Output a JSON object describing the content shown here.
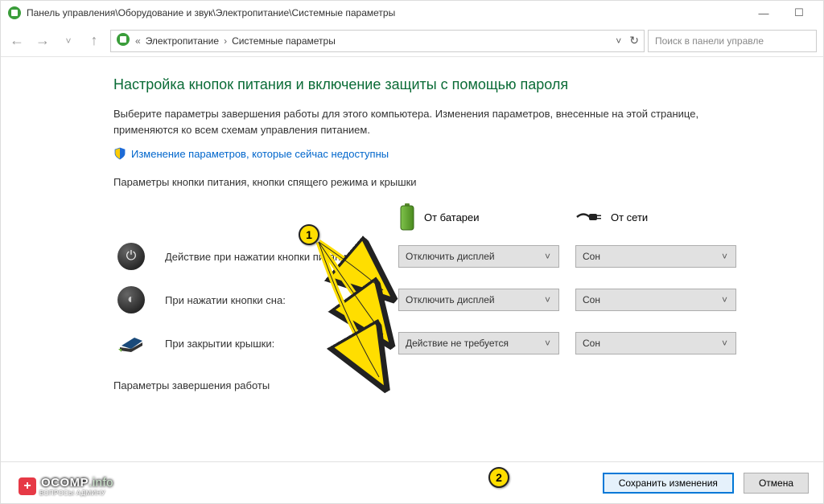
{
  "title": "Панель управления\\Оборудование и звук\\Электропитание\\Системные параметры",
  "breadcrumb": {
    "a": "Электропитание",
    "b": "Системные параметры"
  },
  "search_placeholder": "Поиск в панели управле",
  "page": {
    "heading": "Настройка кнопок питания и включение защиты с помощью пароля",
    "desc": "Выберите параметры завершения работы для этого компьютера. Изменения параметров, внесенные на этой странице, применяются ко всем схемам управления питанием.",
    "link": "Изменение параметров, которые сейчас недоступны",
    "section1": "Параметры кнопки питания, кнопки спящего режима и крышки",
    "col_battery": "От батареи",
    "col_plugged": "От сети",
    "rows": [
      {
        "label": "Действие при нажатии кнопки питания:",
        "battery": "Отключить дисплей",
        "plugged": "Сон"
      },
      {
        "label": "При нажатии кнопки сна:",
        "battery": "Отключить дисплей",
        "plugged": "Сон"
      },
      {
        "label": "При закрытии крышки:",
        "battery": "Действие не требуется",
        "plugged": "Сон"
      }
    ],
    "section2": "Параметры завершения работы"
  },
  "footer": {
    "save": "Сохранить изменения",
    "cancel": "Отмена"
  },
  "callouts": {
    "c1": "1",
    "c2": "2"
  },
  "watermark": {
    "brand": "OCOMP",
    "suffix": ".info",
    "sub": "ВОПРОСЫ АДМИНУ"
  }
}
